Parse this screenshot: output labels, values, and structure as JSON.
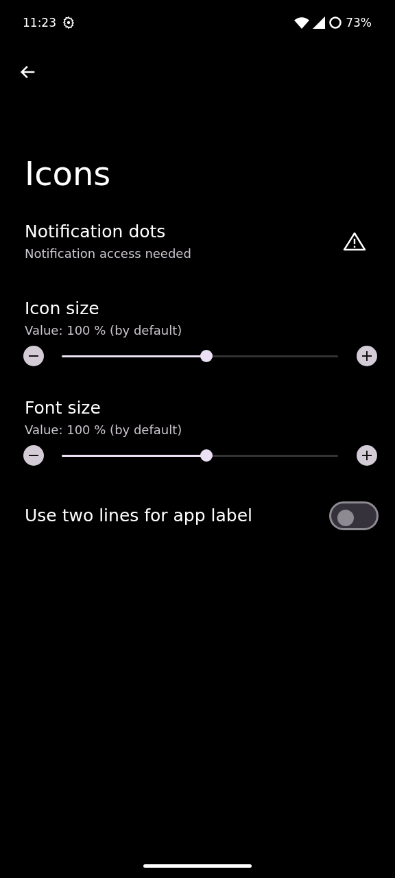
{
  "status_bar": {
    "time": "11:23",
    "battery": "73%"
  },
  "title": "Icons",
  "settings": [
    {
      "kind": "warning",
      "title": "Notification dots",
      "summary": "Notification access needed"
    },
    {
      "kind": "slider",
      "title": "Icon size",
      "summary": "Value: 100 % (by default)",
      "level": 0.5
    },
    {
      "kind": "slider",
      "title": "Font size",
      "summary": "Value: 100 % (by default)",
      "level": 0.5
    },
    {
      "kind": "switch",
      "title": "Use two lines for app label",
      "on": false
    }
  ]
}
